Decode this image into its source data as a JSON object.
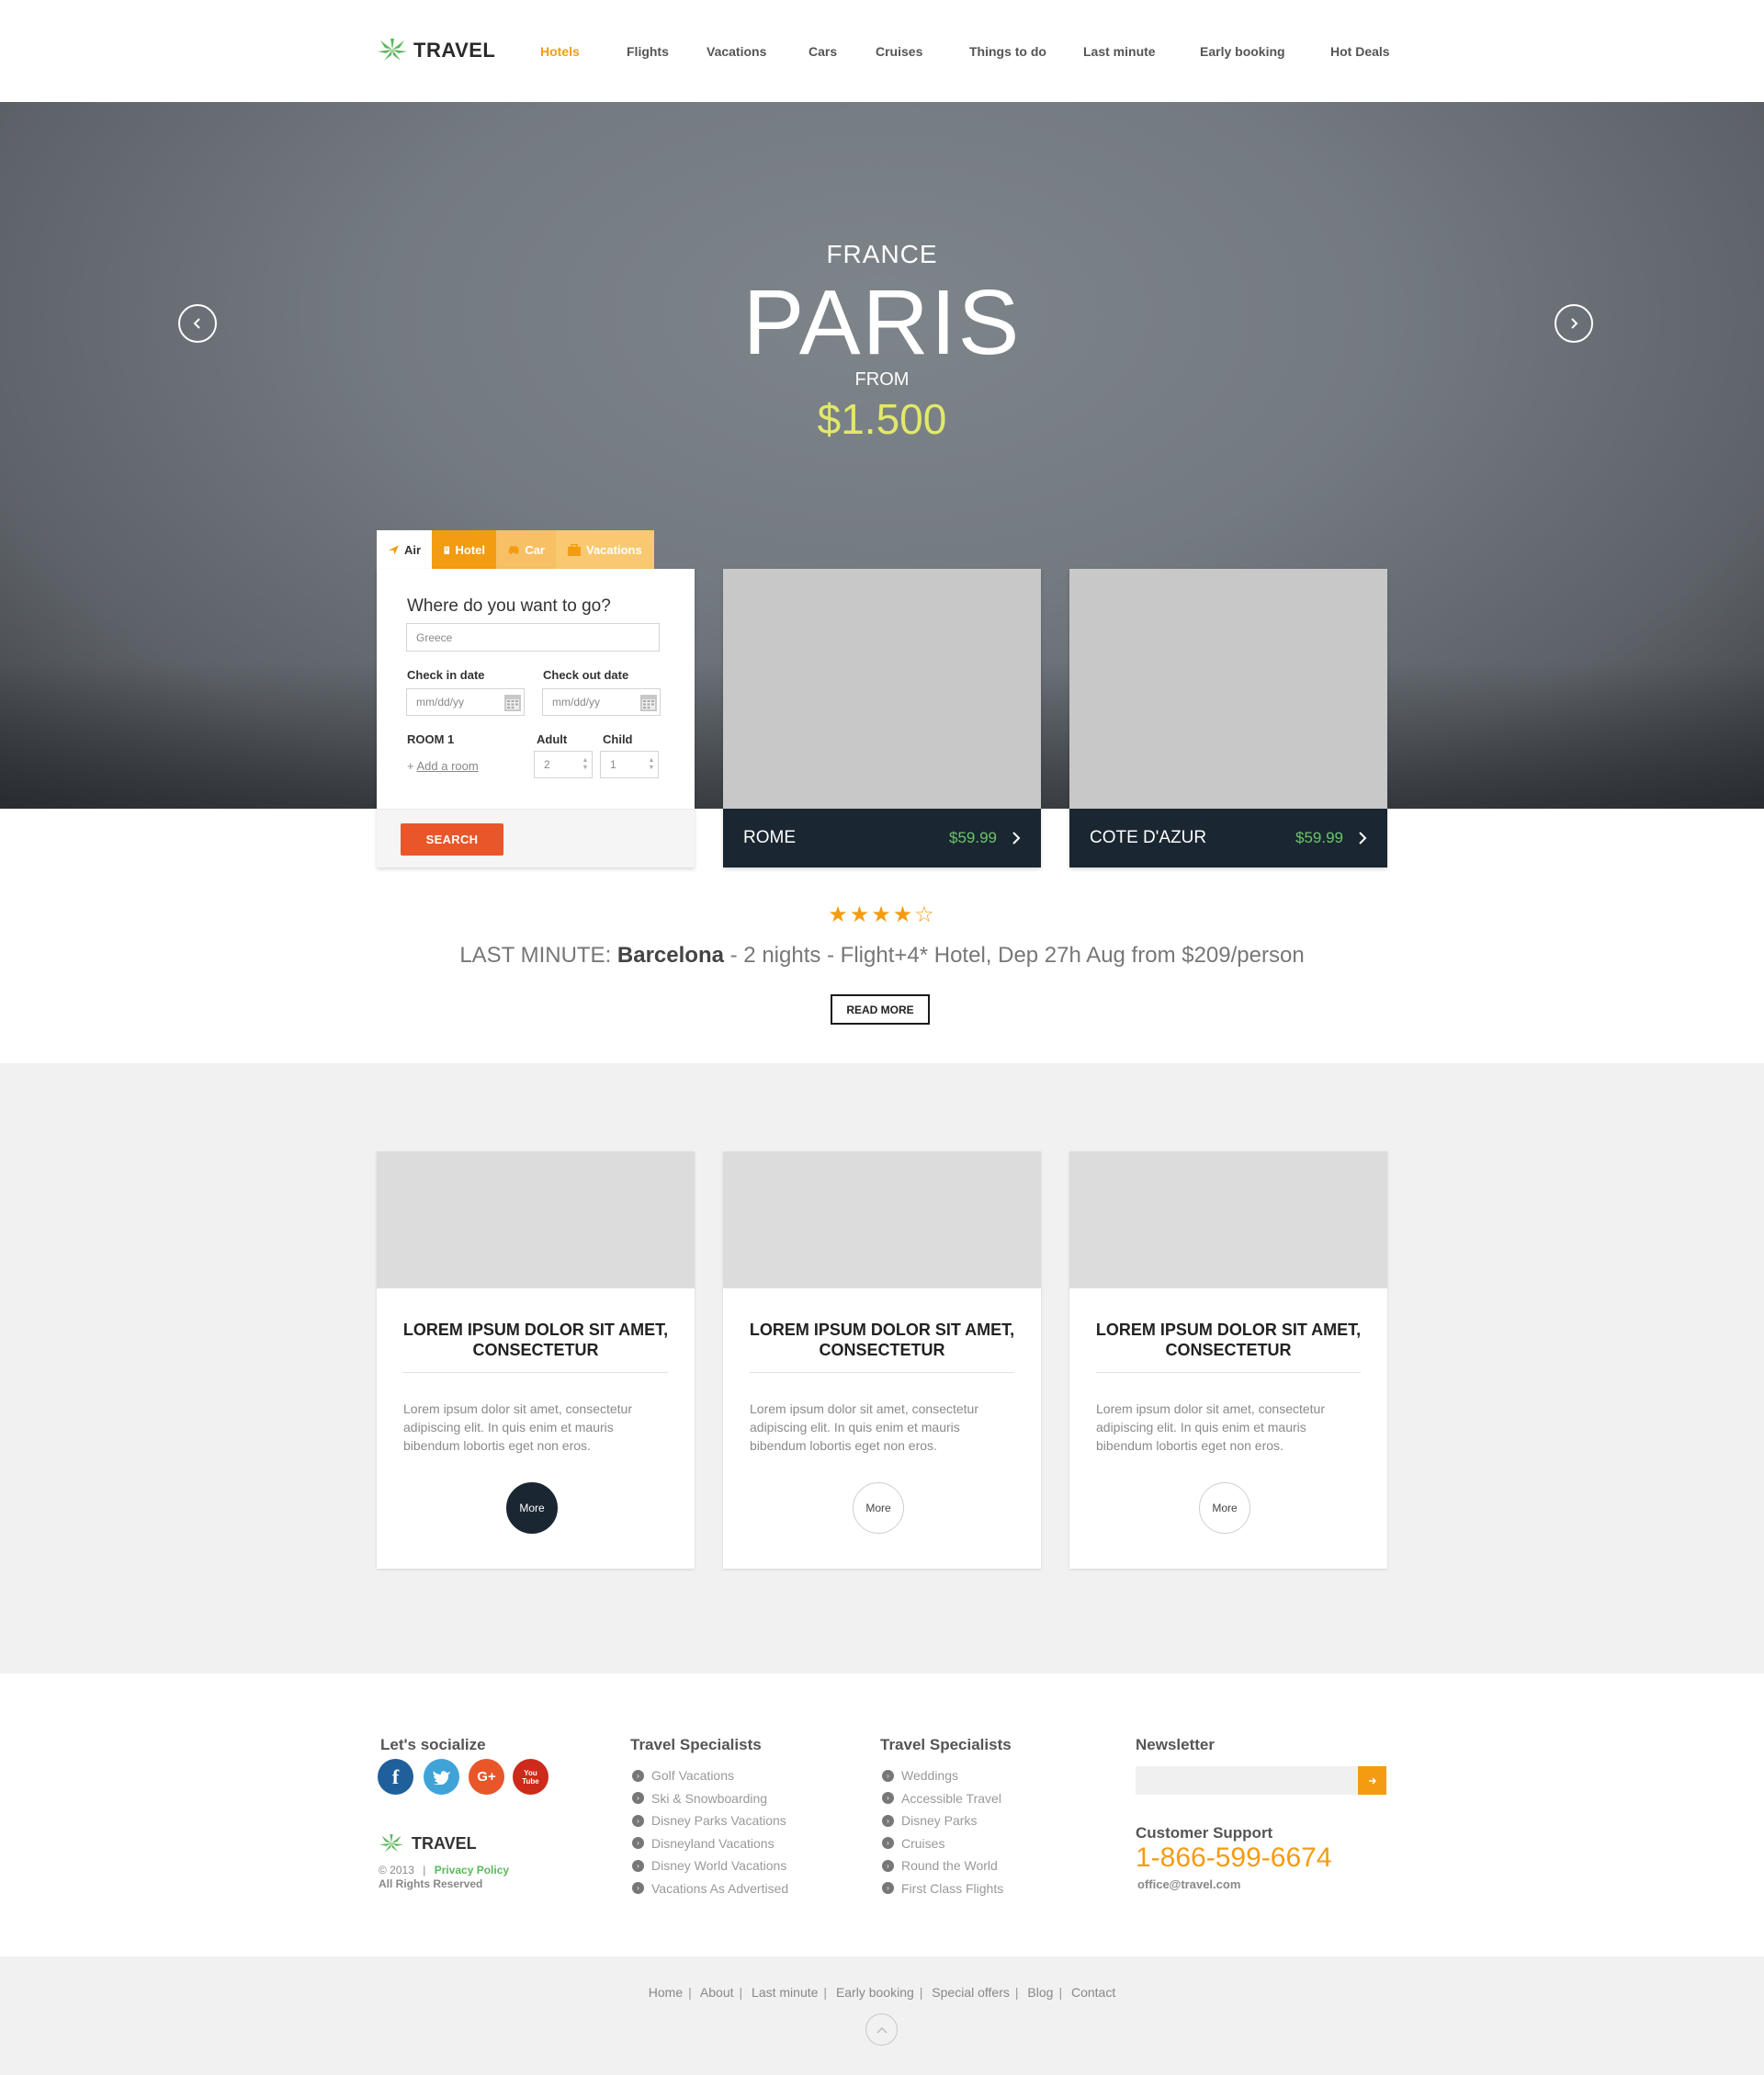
{
  "brand": {
    "name": "TRAVEL"
  },
  "nav": {
    "items": [
      "Hotels",
      "Flights",
      "Vacations",
      "Cars",
      "Cruises",
      "Things to do",
      "Last minute",
      "Early booking",
      "Hot Deals"
    ],
    "active": "Hotels"
  },
  "hero": {
    "country": "FRANCE",
    "city": "PARIS",
    "from_label": "FROM",
    "price": "$1.500"
  },
  "search": {
    "tabs": [
      "Air",
      "Hotel",
      "Car",
      "Vacations"
    ],
    "question": "Where do you want to go?",
    "destination_value": "Greece",
    "checkin_label": "Check in date",
    "checkout_label": "Check out date",
    "date_placeholder": "mm/dd/yy",
    "room_label": "ROOM 1",
    "adult_label": "Adult",
    "child_label": "Child",
    "adult_value": "2",
    "child_value": "1",
    "add_room_prefix": "+",
    "add_room": "Add a room",
    "button": "SEARCH"
  },
  "destinations": [
    {
      "name": "ROME",
      "price": "$59.99"
    },
    {
      "name": "COTE D'AZUR",
      "price": "$59.99"
    }
  ],
  "last_minute": {
    "rating": 4,
    "max_rating": 5,
    "prefix": "LAST MINUTE:",
    "city": "Barcelona",
    "details": " - 2 nights - Flight+4* Hotel, Dep 27h Aug from $209/person",
    "button": "READ MORE"
  },
  "features": [
    {
      "title": "LOREM IPSUM DOLOR SIT AMET, CONSECTETUR",
      "text": "Lorem ipsum dolor sit amet, consectetur adipiscing elit. In quis enim et mauris bibendum lobortis eget non eros.",
      "button": "More"
    },
    {
      "title": "LOREM IPSUM DOLOR SIT AMET, CONSECTETUR",
      "text": "Lorem ipsum dolor sit amet, consectetur adipiscing elit. In quis enim et mauris bibendum lobortis eget non eros.",
      "button": "More"
    },
    {
      "title": "LOREM IPSUM DOLOR SIT AMET, CONSECTETUR",
      "text": "Lorem ipsum dolor sit amet, consectetur adipiscing elit. In quis enim et mauris bibendum lobortis eget non eros.",
      "button": "More"
    }
  ],
  "footer": {
    "social_heading": "Let's socialize",
    "social": [
      {
        "name": "facebook",
        "glyph": "f",
        "color": "#1f5f9a"
      },
      {
        "name": "twitter",
        "glyph": "t",
        "color": "#3fa3d8"
      },
      {
        "name": "google-plus",
        "glyph": "G+",
        "color": "#e8562a"
      },
      {
        "name": "youtube",
        "glyph": "You Tube",
        "color": "#cc2a1a"
      }
    ],
    "copyright": "© 2013",
    "privacy": "Privacy Policy",
    "rights": "All Rights Reserved",
    "col1_heading": "Travel Specialists",
    "col1": [
      "Golf Vacations",
      "Ski & Snowboarding",
      "Disney Parks Vacations",
      "Disneyland Vacations",
      "Disney World Vacations",
      "Vacations As Advertised"
    ],
    "col2_heading": "Travel Specialists",
    "col2": [
      "Weddings",
      "Accessible Travel",
      "Disney Parks",
      "Cruises",
      "Round the World",
      "First Class Flights"
    ],
    "newsletter_heading": "Newsletter",
    "support_heading": "Customer Support",
    "phone": "1-866-599-6674",
    "email": "office@travel.com"
  },
  "bottom_links": [
    "Home",
    "About",
    "Last minute",
    "Early booking",
    "Special offers",
    "Blog",
    "Contact"
  ],
  "colors": {
    "accent": "#f39c12",
    "dark": "#1a2631",
    "search": "#e8562a",
    "price_green": "#6cc36c",
    "hero_price": "#e2e86a"
  }
}
